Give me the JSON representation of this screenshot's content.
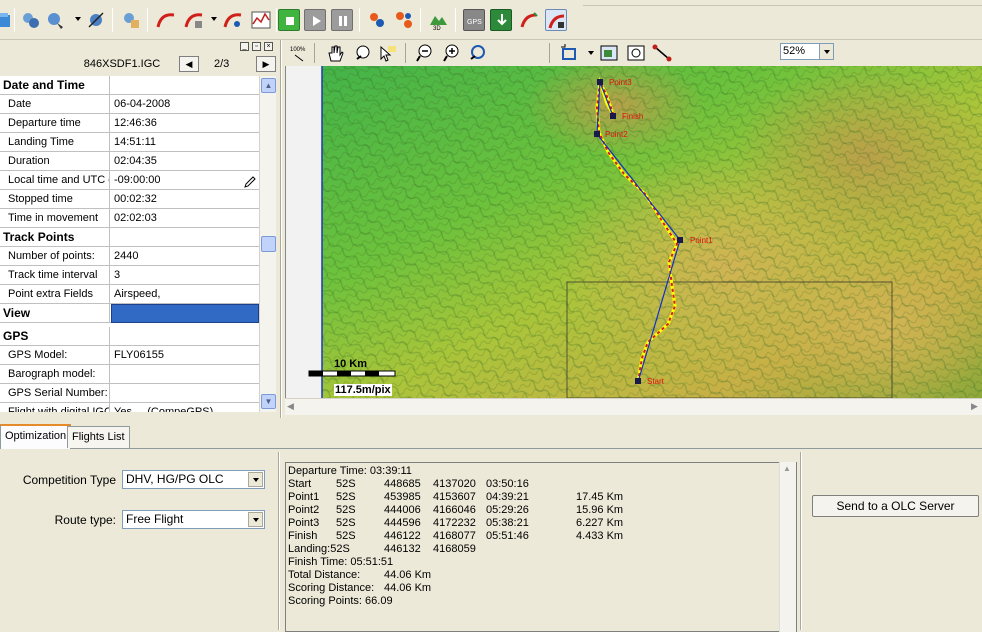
{
  "file": {
    "name": "846XSDF1.IGC",
    "page": "2/3",
    "prev": "◀",
    "next": "▶"
  },
  "grid": {
    "rows": [
      {
        "type": "cat",
        "key": "Date and Time"
      },
      {
        "type": "row",
        "key": "Date",
        "value": "06-04-2008"
      },
      {
        "type": "row",
        "key": "Departure time",
        "value": "12:46:36"
      },
      {
        "type": "row",
        "key": "Landing Time",
        "value": "14:51:11"
      },
      {
        "type": "row",
        "key": "Duration",
        "value": "02:04:35"
      },
      {
        "type": "row",
        "key": "Local time and UTC d",
        "value": "-09:00:00"
      },
      {
        "type": "row",
        "key": "Stopped time",
        "value": "00:02:32"
      },
      {
        "type": "row",
        "key": "Time in movement",
        "value": "02:02:03"
      },
      {
        "type": "cat",
        "key": "Track Points"
      },
      {
        "type": "row",
        "key": "Number of points:",
        "value": "2440"
      },
      {
        "type": "row",
        "key": "Track time interval",
        "value": "3"
      },
      {
        "type": "row",
        "key": "Point extra Fields",
        "value": "Airspeed,"
      },
      {
        "type": "sel",
        "key": "View",
        "value": ""
      },
      {
        "type": "cat",
        "key": "GPS"
      },
      {
        "type": "row",
        "key": "GPS Model:",
        "value": "FLY06155"
      },
      {
        "type": "row",
        "key": "Barograph model:",
        "value": ""
      },
      {
        "type": "row",
        "key": "GPS Serial Number:",
        "value": ""
      },
      {
        "type": "row",
        "key": "Flight with digital IGC",
        "value": "Yes ... (CompeGPS)"
      }
    ]
  },
  "map_toolbar": {
    "zoom": "52%"
  },
  "map": {
    "scale_label": "10 Km",
    "scale_res": "117.5m/pix",
    "waypoints": [
      "Point3",
      "Finish",
      "Point2",
      "Point1",
      "Start"
    ]
  },
  "tabs": [
    "Optimization",
    "Flights List"
  ],
  "optimization": {
    "competition_label": "Competition Type",
    "competition_value": "DHV, HG/PG OLC",
    "route_label": "Route type:",
    "route_value": "Free Flight",
    "send_button": "Send to a OLC Server",
    "departure": "Departure Time: 03:39:11",
    "points": [
      {
        "name": "Start",
        "zone": "52S",
        "e": "448685",
        "n": "4137020",
        "t": "03:50:16",
        "d": ""
      },
      {
        "name": "Point1",
        "zone": "52S",
        "e": "453985",
        "n": "4153607",
        "t": "04:39:21",
        "d": "17.45 Km"
      },
      {
        "name": "Point2",
        "zone": "52S",
        "e": "444006",
        "n": "4166046",
        "t": "05:29:26",
        "d": "15.96 Km"
      },
      {
        "name": "Point3",
        "zone": "52S",
        "e": "444596",
        "n": "4172232",
        "t": "05:38:21",
        "d": "6.227 Km"
      },
      {
        "name": "Finish",
        "zone": "52S",
        "e": "446122",
        "n": "4168077",
        "t": "05:51:46",
        "d": "4.433 Km"
      }
    ],
    "landing_label": "Landing:52S",
    "landing_e": "446132",
    "landing_n": "4168059",
    "finish_time": "Finish Time: 05:51:51",
    "total_label": "Total Distance:",
    "total_value": "44.06 Km",
    "scoring_label": "Scoring Distance:",
    "scoring_value": "44.06 Km",
    "points_label": "Scoring Points: 66.09"
  }
}
